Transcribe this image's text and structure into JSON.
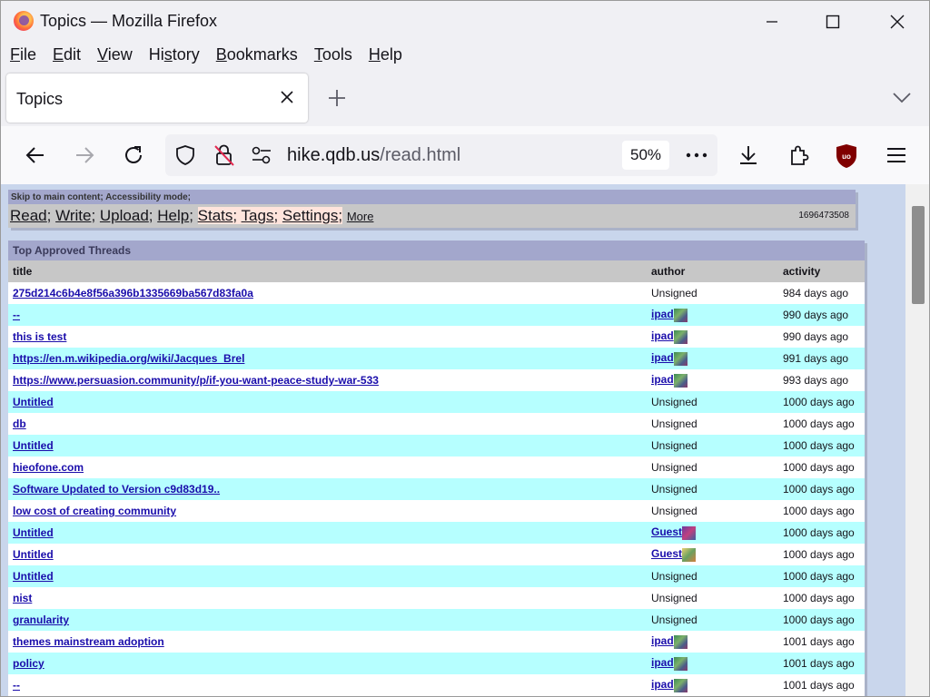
{
  "window": {
    "title": "Topics — Mozilla Firefox"
  },
  "menu": [
    "File",
    "Edit",
    "View",
    "History",
    "Bookmarks",
    "Tools",
    "Help"
  ],
  "menu_access_keys": [
    "F",
    "E",
    "V",
    "s",
    "B",
    "T",
    "H"
  ],
  "tab": {
    "title": "Topics"
  },
  "urlbar": {
    "host": "hike.qdb.us",
    "path": "/read.html",
    "zoom": "50%"
  },
  "page": {
    "skip_text": "Skip to main content; Accessibility mode;",
    "nav": {
      "read": "Read",
      "write": "Write",
      "upload": "Upload",
      "help": "Help",
      "stats": "Stats",
      "tags": "Tags",
      "settings": "Settings",
      "more": "More"
    },
    "timestamp": "1696473508",
    "threads_title": "Top Approved Threads",
    "columns": {
      "title": "title",
      "author": "author",
      "activity": "activity"
    },
    "rows": [
      {
        "title": "275d214c6b4e8f56a396b1335669ba567d83fa0a",
        "author": "Unsigned",
        "avatar": "",
        "activity": "984 days ago",
        "cyan": false
      },
      {
        "title": "--",
        "author": "ipad",
        "avatar": "green",
        "activity": "990 days ago",
        "cyan": true
      },
      {
        "title": "this is test",
        "author": "ipad",
        "avatar": "green",
        "activity": "990 days ago",
        "cyan": false
      },
      {
        "title": "https://en.m.wikipedia.org/wiki/Jacques_Brel",
        "author": "ipad",
        "avatar": "green",
        "activity": "991 days ago",
        "cyan": true
      },
      {
        "title": "https://www.persuasion.community/p/if-you-want-peace-study-war-533",
        "author": "ipad",
        "avatar": "green",
        "activity": "993 days ago",
        "cyan": false
      },
      {
        "title": "Untitled",
        "author": "Unsigned",
        "avatar": "",
        "activity": "1000 days ago",
        "cyan": true
      },
      {
        "title": "db",
        "author": "Unsigned",
        "avatar": "",
        "activity": "1000 days ago",
        "cyan": false
      },
      {
        "title": "Untitled",
        "author": "Unsigned",
        "avatar": "",
        "activity": "1000 days ago",
        "cyan": true
      },
      {
        "title": "hieofone.com",
        "author": "Unsigned",
        "avatar": "",
        "activity": "1000 days ago",
        "cyan": false
      },
      {
        "title": "Software Updated to Version c9d83d19..",
        "author": "Unsigned",
        "avatar": "",
        "activity": "1000 days ago",
        "cyan": true
      },
      {
        "title": "low cost of creating community",
        "author": "Unsigned",
        "avatar": "",
        "activity": "1000 days ago",
        "cyan": false
      },
      {
        "title": "Untitled",
        "author": "Guest",
        "avatar": "purple",
        "activity": "1000 days ago",
        "cyan": true
      },
      {
        "title": "Untitled",
        "author": "Guest",
        "avatar": "yellow",
        "activity": "1000 days ago",
        "cyan": false
      },
      {
        "title": "Untitled",
        "author": "Unsigned",
        "avatar": "",
        "activity": "1000 days ago",
        "cyan": true
      },
      {
        "title": "nist",
        "author": "Unsigned",
        "avatar": "",
        "activity": "1000 days ago",
        "cyan": false
      },
      {
        "title": "granularity",
        "author": "Unsigned",
        "avatar": "",
        "activity": "1000 days ago",
        "cyan": true
      },
      {
        "title": "themes mainstream adoption",
        "author": "ipad",
        "avatar": "green",
        "activity": "1001 days ago",
        "cyan": false
      },
      {
        "title": "policy",
        "author": "ipad",
        "avatar": "green",
        "activity": "1001 days ago",
        "cyan": true
      },
      {
        "title": "--",
        "author": "ipad",
        "avatar": "green",
        "activity": "1001 days ago",
        "cyan": false
      }
    ]
  },
  "colors": {
    "row_alt": "#b6ffff",
    "header_bar": "#a3a7cc",
    "nav_bar": "#c7c7c7",
    "link": "#1a0dab"
  }
}
